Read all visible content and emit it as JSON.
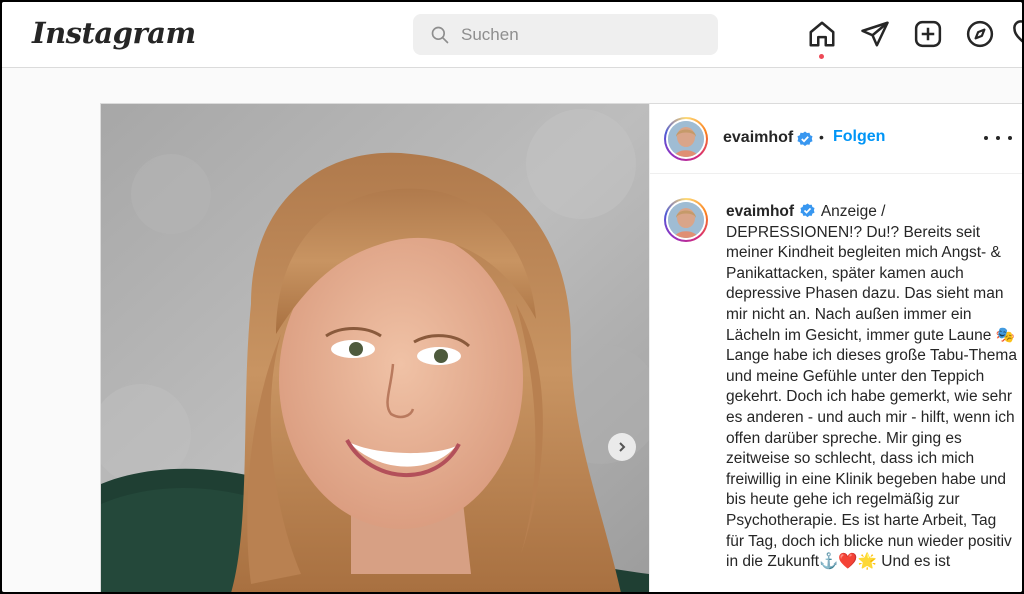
{
  "header": {
    "logo": "Instagram",
    "search_placeholder": "Suchen"
  },
  "nav": {
    "icons": [
      "home-icon",
      "direct-message-icon",
      "new-post-icon",
      "explore-icon",
      "activity-icon"
    ]
  },
  "post": {
    "username": "evaimhof",
    "separator": "•",
    "follow_label": "Folgen",
    "caption_username": "evaimhof",
    "caption_text": "Anzeige / DEPRESSIONEN!? Du!? Bereits seit meiner Kindheit begleiten mich Angst- & Panikattacken, später kamen auch depressive Phasen dazu. Das sieht man mir nicht an. Nach außen immer ein Lächeln im Gesicht, immer gute Laune 🎭 Lange habe ich dieses große Tabu-Thema und meine Gefühle unter den Teppich gekehrt. Doch ich habe gemerkt, wie sehr es anderen - und auch mir - hilft, wenn ich offen darüber spreche. Mir ging es zeitweise so schlecht, dass ich mich freiwillig in eine Klinik begeben habe und bis heute gehe ich regelmäßig zur Psychotherapie. Es ist harte Arbeit, Tag für Tag, doch ich blicke nun wieder positiv in die Zukunft⚓️❤️🌟 Und es ist"
  },
  "colors": {
    "link": "#0095f6",
    "verified": "#3897f0",
    "notification_dot": "#ed4956"
  }
}
